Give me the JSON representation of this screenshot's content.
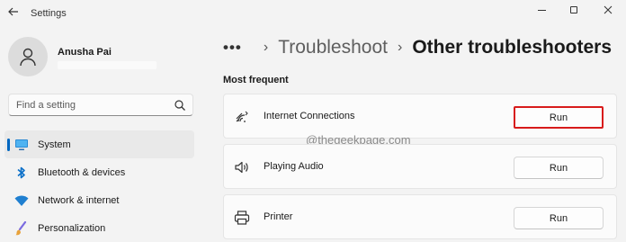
{
  "window": {
    "title": "Settings",
    "back_icon": "arrow-left-icon",
    "min_icon": "minimize-icon",
    "max_icon": "maximize-icon",
    "close_icon": "close-icon"
  },
  "profile": {
    "name": "Anusha Pai",
    "avatar_icon": "person-icon"
  },
  "search": {
    "placeholder": "Find a setting",
    "icon": "search-icon"
  },
  "sidebar": {
    "items": [
      {
        "label": "System",
        "icon": "monitor-icon",
        "active": true
      },
      {
        "label": "Bluetooth & devices",
        "icon": "bluetooth-icon",
        "active": false
      },
      {
        "label": "Network & internet",
        "icon": "wifi-icon",
        "active": false
      },
      {
        "label": "Personalization",
        "icon": "paintbrush-icon",
        "active": false
      }
    ]
  },
  "breadcrumb": {
    "overflow": "•••",
    "sep": "›",
    "items": [
      "Troubleshoot",
      "Other troubleshooters"
    ]
  },
  "main": {
    "section_title": "Most frequent",
    "watermark": "@thegeekpage.com",
    "troubleshooters": [
      {
        "label": "Internet Connections",
        "icon": "network-signal-icon",
        "button": "Run",
        "highlighted": true
      },
      {
        "label": "Playing Audio",
        "icon": "speaker-icon",
        "button": "Run",
        "highlighted": false
      },
      {
        "label": "Printer",
        "icon": "printer-icon",
        "button": "Run",
        "highlighted": false
      }
    ]
  },
  "colors": {
    "accent": "#0067c0",
    "highlight_border": "#d81b1b",
    "background": "#f3f3f3"
  }
}
